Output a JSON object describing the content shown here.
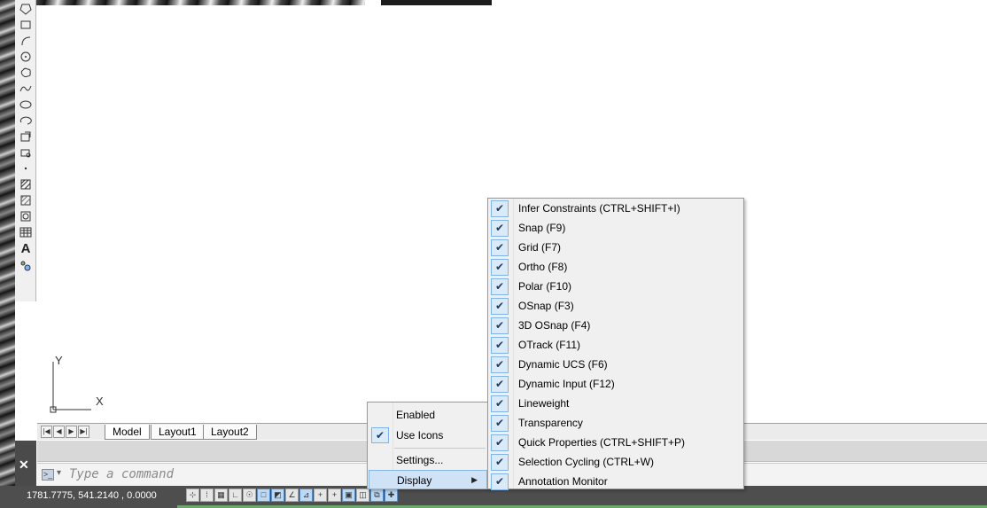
{
  "layout_tabs": [
    "Model",
    "Layout1",
    "Layout2"
  ],
  "layout_nav": [
    "|◀",
    "◀",
    "▶",
    "▶|"
  ],
  "ucs": {
    "x_label": "X",
    "y_label": "Y"
  },
  "command": {
    "placeholder": "Type a command",
    "close_glyph": "✕"
  },
  "status": {
    "coordinates": "1781.7775, 541.2140 , 0.0000",
    "icons": [
      "infer-constraints",
      "snap",
      "grid",
      "ortho",
      "polar",
      "osnap",
      "3d-osnap",
      "otrack",
      "dynamic-ucs",
      "dynamic-input",
      "lineweight",
      "transparency",
      "quick-properties",
      "selection-cycling",
      "annotation-monitor"
    ]
  },
  "context_menu": {
    "items": [
      {
        "label": "Enabled",
        "checked": false
      },
      {
        "label": "Use Icons",
        "checked": true
      },
      {
        "label": "Settings...",
        "checked": false
      },
      {
        "label": "Display",
        "checked": false,
        "submenu": true
      }
    ],
    "check_glyph": "✔",
    "submenu_arrow": "▶"
  },
  "display_submenu": {
    "items": [
      {
        "label": "Infer Constraints (CTRL+SHIFT+I)",
        "checked": true
      },
      {
        "label": "Snap (F9)",
        "checked": true
      },
      {
        "label": "Grid (F7)",
        "checked": true
      },
      {
        "label": "Ortho (F8)",
        "checked": true
      },
      {
        "label": "Polar (F10)",
        "checked": true
      },
      {
        "label": "OSnap (F3)",
        "checked": true
      },
      {
        "label": "3D OSnap (F4)",
        "checked": true
      },
      {
        "label": "OTrack (F11)",
        "checked": true
      },
      {
        "label": "Dynamic UCS (F6)",
        "checked": true
      },
      {
        "label": "Dynamic Input (F12)",
        "checked": true
      },
      {
        "label": "Lineweight",
        "checked": true
      },
      {
        "label": "Transparency",
        "checked": true
      },
      {
        "label": "Quick Properties (CTRL+SHIFT+P)",
        "checked": true
      },
      {
        "label": "Selection Cycling (CTRL+W)",
        "checked": true
      },
      {
        "label": "Annotation Monitor",
        "checked": true
      }
    ]
  },
  "draw_toolbar": {
    "tools": [
      "polygon-icon",
      "rectangle-icon",
      "arc-icon",
      "circle-icon",
      "revision-cloud-icon",
      "spline-icon",
      "ellipse-icon",
      "ellipse-arc-icon",
      "insert-block-icon",
      "make-block-icon",
      "point-icon",
      "hatch-icon",
      "gradient-icon",
      "region-icon",
      "table-icon",
      "multiline-text-icon",
      "add-selected-icon"
    ],
    "text_tool_glyph": "A"
  },
  "colors": {
    "menu_bg": "#f0f0f0",
    "check_bg": "#dbeaf7",
    "check_border": "#7eb4ea",
    "status_bar": "#4e4e4e"
  }
}
